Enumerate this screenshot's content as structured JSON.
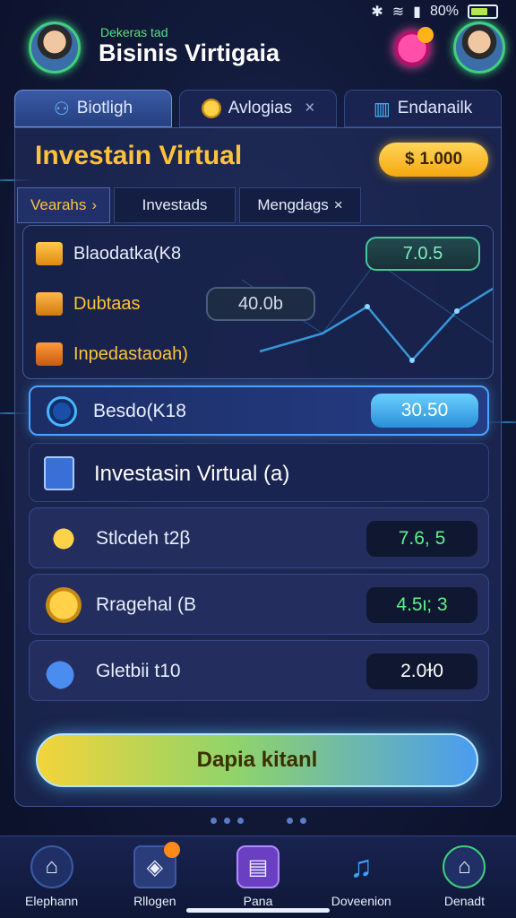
{
  "status_bar": {
    "battery": "80%",
    "icons": [
      "bluetooth-icon",
      "wifi-icon",
      "signal-icon",
      "battery-icon"
    ]
  },
  "header": {
    "subtitle": "Dekeras tad",
    "title": "Bisinis Virtigaia"
  },
  "top_tabs": [
    {
      "label": "Biotligh",
      "icon": "users-icon",
      "active": true
    },
    {
      "label": "Avlogias",
      "icon": "coin-icon",
      "active": false,
      "close": "×"
    },
    {
      "label": "Endanailk",
      "icon": "bar-chart-icon",
      "active": false
    }
  ],
  "panel": {
    "title": "Investain Virtual",
    "coins": "1.000",
    "coins_prefix": "$"
  },
  "sub_tabs": [
    {
      "label": "Vearahs",
      "active": true,
      "suffix": "›"
    },
    {
      "label": "Investads",
      "active": false
    },
    {
      "label": "Mengdags",
      "active": false,
      "suffix": "×"
    }
  ],
  "stats": {
    "rows": [
      {
        "label": "Blaodatka(K8",
        "icon": "gold-bar-icon"
      },
      {
        "label": "Dubtaas",
        "icon": "document-icon"
      },
      {
        "label": "Inpedastaoah)",
        "icon": "growth-chart-icon"
      }
    ],
    "values": [
      "7.0.5",
      "40.0b"
    ]
  },
  "highlight": {
    "label": "Besdo(K18",
    "value": "30.50"
  },
  "section": {
    "label": "Investasin Virtual (a)"
  },
  "assets": [
    {
      "label": "Stlcdeh t2β",
      "value": "7.6, 5",
      "value_color": "#5ff08a",
      "icon": "rocket-icon",
      "icon_color": "#f5b51a"
    },
    {
      "label": "Rragehal (B",
      "value": "4.5ι; 3",
      "value_color": "#5ff08a",
      "icon": "gold-coin-icon",
      "icon_color": "#f0a81a"
    },
    {
      "label": "Gletbii t10",
      "value": "2.0ɫ0",
      "value_color": "#ffffff",
      "icon": "cloud-icon",
      "icon_color": "#4a8cf0"
    }
  ],
  "cta": {
    "label": "Dapia kitanl"
  },
  "bottom_nav": [
    {
      "label": "Elephann",
      "icon": "home-icon",
      "glyph": "⌂"
    },
    {
      "label": "Rllogen",
      "icon": "briefcase-icon",
      "glyph": "◈",
      "badge": true
    },
    {
      "label": "Pana",
      "icon": "store-icon",
      "glyph": "▤"
    },
    {
      "label": "Doveenion",
      "icon": "music-icon",
      "glyph": "♫"
    },
    {
      "label": "Denadt",
      "icon": "lock-home-icon",
      "glyph": "⌂"
    }
  ],
  "colors": {
    "accent": "#ffc23a",
    "green": "#3fd07a",
    "blue": "#4aa4ff"
  }
}
